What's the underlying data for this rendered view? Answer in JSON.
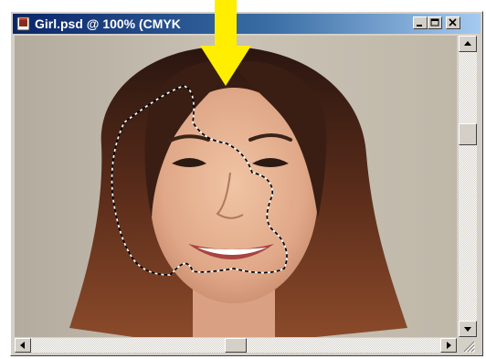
{
  "window": {
    "title": "Girl.psd @ 100% (CMYK",
    "title_icon": "photoshop-document-icon",
    "controls": [
      "minimize-icon",
      "maximize-icon",
      "close-icon"
    ]
  },
  "canvas": {
    "content": "portrait photo of a smiling woman with a dashed marquee selection over the left side of her face"
  },
  "annotation": {
    "arrow_color": "#ffee00",
    "arrow_icon": "down-arrow-icon"
  },
  "colors": {
    "titlebar_start": "#0a246a",
    "titlebar_end": "#a6caf0",
    "chrome": "#d4d0c8"
  }
}
